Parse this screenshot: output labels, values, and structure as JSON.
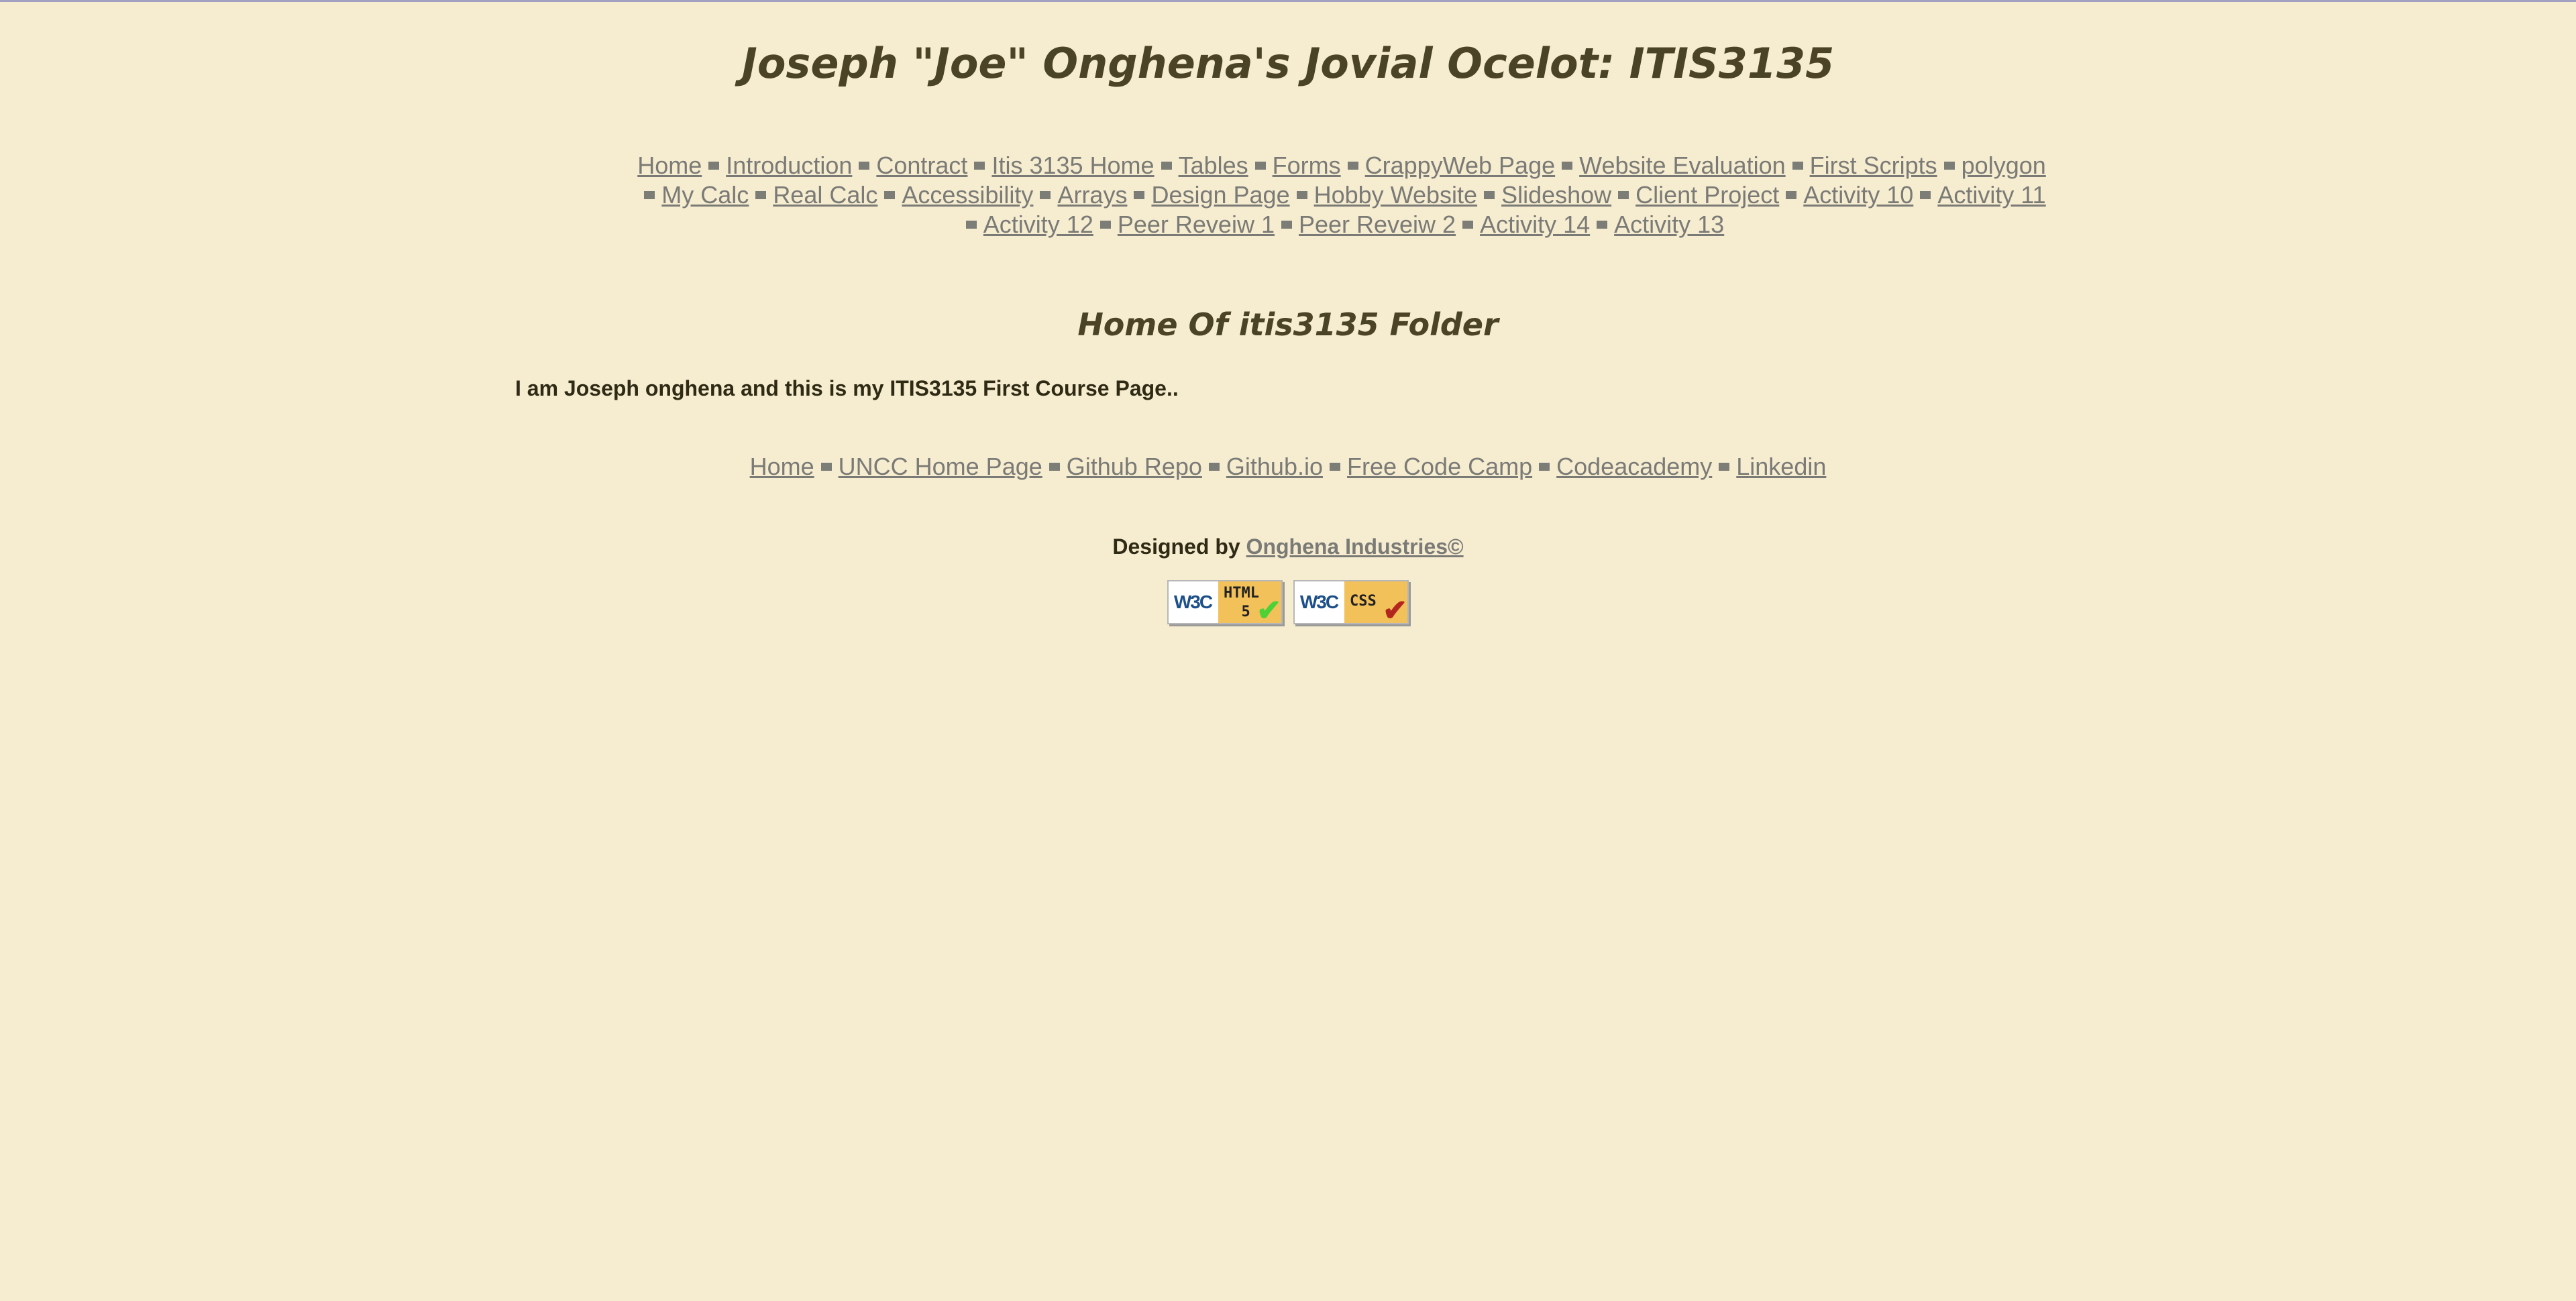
{
  "header": {
    "title": "Joseph \"Joe\" Onghena's Jovial Ocelot: ITIS3135"
  },
  "main_nav": {
    "links": [
      "Home",
      "Introduction",
      "Contract",
      "Itis 3135 Home",
      "Tables",
      "Forms",
      "CrappyWeb Page",
      "Website Evaluation",
      "First Scripts",
      "polygon",
      "My Calc",
      "Real Calc",
      "Accessibility",
      "Arrays",
      "Design Page",
      "Hobby Website",
      "Slideshow",
      "Client Project",
      "Activity 10",
      "Activity 11",
      "Activity 12",
      "Peer Reveiw 1",
      "Peer Reveiw 2",
      "Activity 14",
      "Activity 13"
    ]
  },
  "main": {
    "heading": "Home Of itis3135 Folder",
    "intro": "I am Joseph onghena and this is my ITIS3135 First Course Page.."
  },
  "footer_nav": {
    "links": [
      "Home",
      "UNCC Home Page",
      "Github Repo",
      "Github.io",
      "Free Code Camp",
      "Codeacademy",
      "Linkedin"
    ]
  },
  "credit": {
    "prefix": "Designed by",
    "company": "Onghena Industries©"
  },
  "badges": {
    "html": {
      "logo": "W3C",
      "tag_line1": "HTML",
      "tag_line2": "5",
      "check_color": "#4cd137"
    },
    "css": {
      "logo": "W3C",
      "tag_line1": "CSS",
      "check_color": "#b3261e"
    }
  },
  "colors": {
    "background": "#f6ecd0",
    "heading": "#4a4326",
    "link": "#7a7a76",
    "text": "#2e2a14"
  }
}
